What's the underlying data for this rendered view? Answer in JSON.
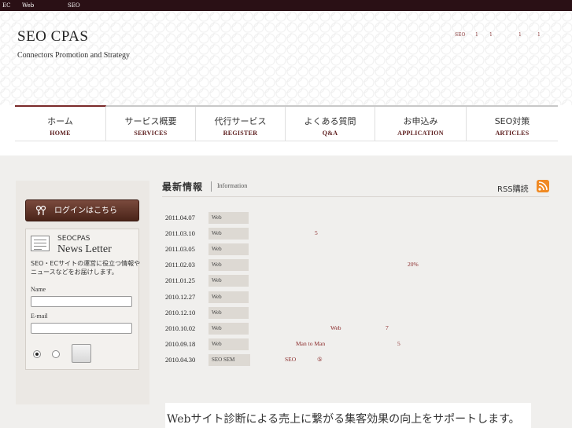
{
  "topbar": {
    "items": [
      "EC",
      "Web",
      "SEO"
    ]
  },
  "header": {
    "logo": "SEO CPAS",
    "tagline": "Connectors Promotion and Strategy",
    "links": [
      "SEO",
      "1",
      "1",
      "1",
      "1"
    ]
  },
  "nav": {
    "items": [
      {
        "jp": "ホーム",
        "en": "HOME"
      },
      {
        "jp": "サービス概要",
        "en": "SERVICES"
      },
      {
        "jp": "代行サービス",
        "en": "REGISTER"
      },
      {
        "jp": "よくある質問",
        "en": "Q&A"
      },
      {
        "jp": "お申込み",
        "en": "APPLICATION"
      },
      {
        "jp": "SEO対策",
        "en": "ARTICLES"
      }
    ]
  },
  "sidebar": {
    "login_label": "ログインはこちら",
    "newsletter": {
      "title1": "SEOCPAS",
      "title2": "News Letter",
      "desc": "SEO・ECサイトの運営に役立つ情報やニュースなどをお届けします。",
      "name_label": "Name",
      "email_label": "E-mail",
      "name_value": "",
      "email_value": ""
    }
  },
  "news": {
    "title": "最新情報",
    "subtitle": "Information",
    "rss_label": "RSS購読",
    "items": [
      {
        "date": "2011.04.07",
        "tag": "Web",
        "text": ""
      },
      {
        "date": "2011.03.10",
        "tag": "Web",
        "text": "5"
      },
      {
        "date": "2011.03.05",
        "tag": "Web",
        "text": ""
      },
      {
        "date": "2011.02.03",
        "tag": "Web",
        "text": "20%"
      },
      {
        "date": "2011.01.25",
        "tag": "Web",
        "text": ""
      },
      {
        "date": "2010.12.27",
        "tag": "Web",
        "text": ""
      },
      {
        "date": "2010.12.10",
        "tag": "Web",
        "text": ""
      },
      {
        "date": "2010.10.02",
        "tag": "Web",
        "text": "Web",
        "text2": "7"
      },
      {
        "date": "2010.09.18",
        "tag": "Web",
        "text": "Man to Man",
        "text2": "5"
      },
      {
        "date": "2010.04.30",
        "tag": "SEO SEM",
        "text": "SEO",
        "text2": "⑤"
      }
    ]
  },
  "banner": {
    "text": "Webサイト診断による売上に繋がる集客効果の向上をサポートします。"
  },
  "colors": {
    "accent": "#7a2a2a",
    "topbar": "#2a1015",
    "rss": "#f08a24"
  }
}
